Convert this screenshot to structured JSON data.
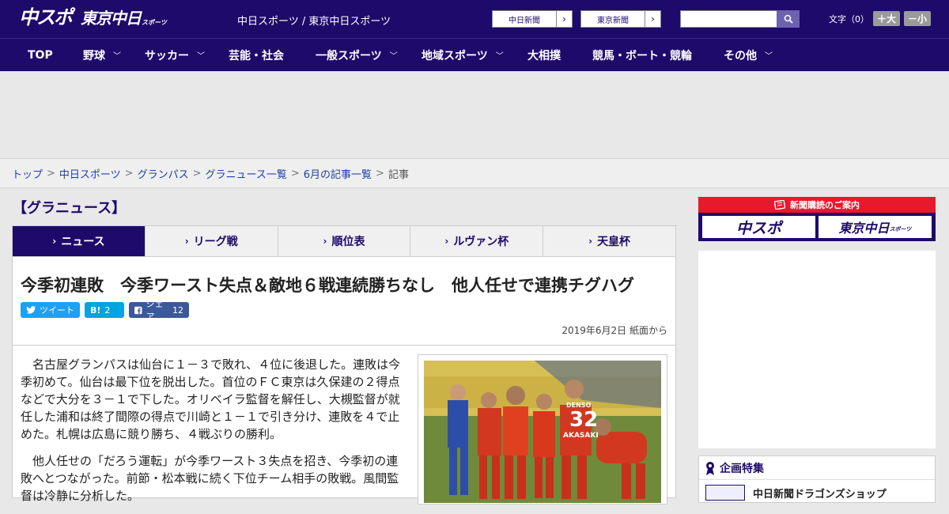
{
  "header": {
    "logo_main": "中スポ",
    "logo_sub": "東京中日",
    "logo_sub_small": "スポーツ",
    "site_name": "中日スポーツ / 東京中日スポーツ",
    "link1": "中日新聞",
    "link2": "東京新聞",
    "fontsize_label": "文字（0）",
    "fontsize_up": "＋大",
    "fontsize_down": "－小"
  },
  "nav": {
    "items": [
      {
        "label": "TOP"
      },
      {
        "label": "野球"
      },
      {
        "label": "サッカー"
      },
      {
        "label": "芸能・社会"
      },
      {
        "label": "一般スポーツ"
      },
      {
        "label": "地域スポーツ"
      },
      {
        "label": "大相撲"
      },
      {
        "label": "競馬・ボート・競輪"
      },
      {
        "label": "その他"
      }
    ]
  },
  "breadcrumb": {
    "items": [
      "トップ",
      "中日スポーツ",
      "グランパス",
      "グラニュース一覧",
      "6月の記事一覧"
    ],
    "current": "記事"
  },
  "section_title": "【グラニュース】",
  "tabs": [
    {
      "label": "ニュース"
    },
    {
      "label": "リーグ戦"
    },
    {
      "label": "順位表"
    },
    {
      "label": "ルヴァン杯"
    },
    {
      "label": "天皇杯"
    }
  ],
  "article": {
    "headline": "今季初連敗　今季ワースト失点＆敵地６戦連続勝ちなし　他人任せで連携チグハグ",
    "tweet_label": "ツイート",
    "hatena_label": "B!",
    "hatena_count": "2",
    "share_label": "シェア",
    "share_count": "12",
    "date": "2019年6月2日 紙面から",
    "paragraph1": "名古屋グランパスは仙台に１－３で敗れ、４位に後退した。連敗は今季初めて。仙台は最下位を脱出した。首位のＦＣ東京は久保建の２得点などで大分を３－１で下した。オリベイラ監督を解任し、大槻監督が就任した浦和は終了間際の得点で川崎と１－１で引き分け、連敗を４で止めた。札幌は広島に競り勝ち、４戦ぶりの勝利。",
    "paragraph2": "他人任せの「だろう運転」が今季ワースト３失点を招き、今季初の連敗へとつながった。前節・松本戦に続く下位チーム相手の敗戦。風間監督は冷静に分析した。",
    "photo_jersey": "32",
    "photo_sponsor": "DENSO",
    "photo_name": "AKASAKI"
  },
  "sidebar": {
    "subscribe_label": "新聞購読のご案内",
    "subscribe_btn1": "中スポ",
    "subscribe_btn2": "東京中日",
    "subscribe_btn2_small": "スポーツ",
    "feature_title": "企画特集",
    "feature_item": "中日新聞ドラゴンズショップ"
  },
  "colors": {
    "brand": "#1e0a6b",
    "accent_red": "#e8182d"
  }
}
